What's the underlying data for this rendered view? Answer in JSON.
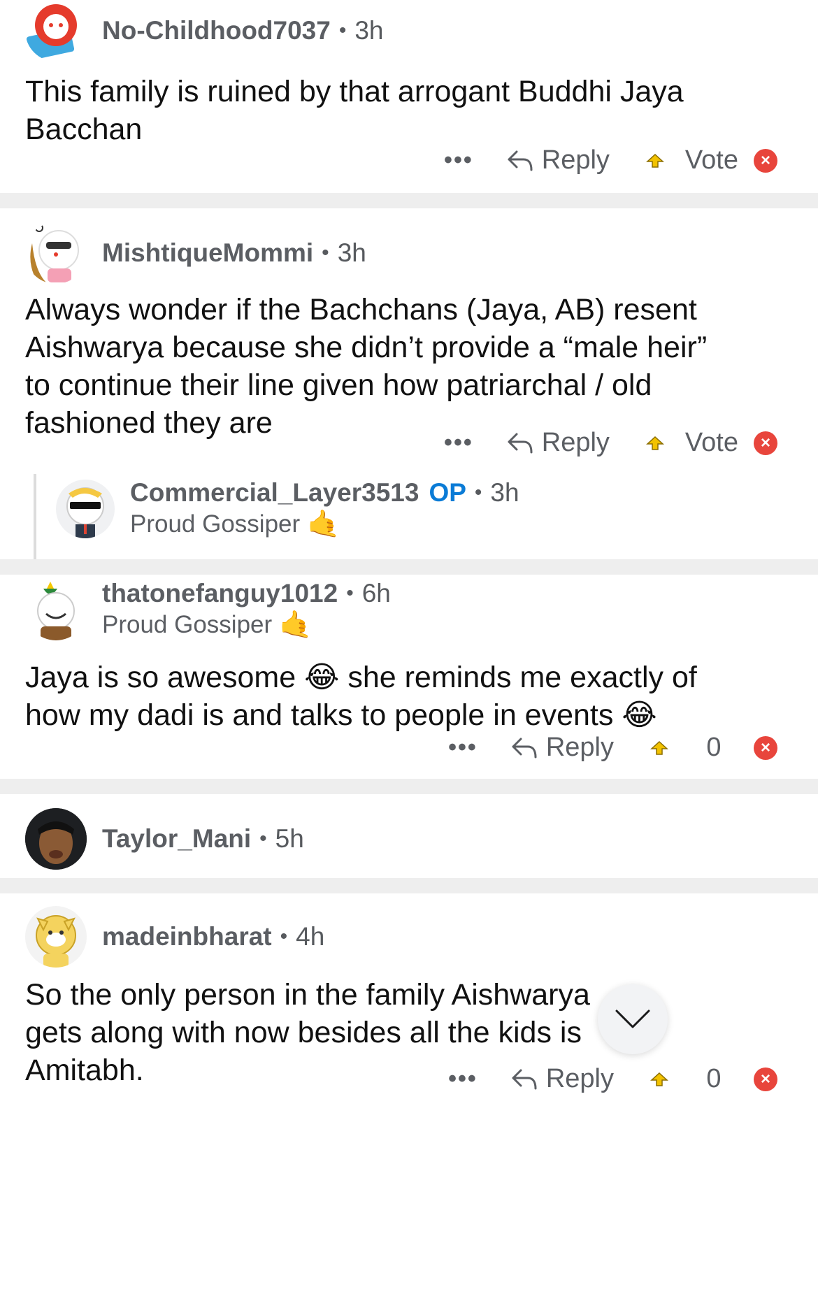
{
  "comments": [
    {
      "username": "No-Childhood7037",
      "time": "3h",
      "text": "This family is ruined by that  arrogant Buddhi Jaya Bacchan",
      "actions": {
        "more": "•••",
        "reply": "Reply",
        "vote": "Vote"
      }
    },
    {
      "username": "MishtiqueMommi",
      "time": "3h",
      "text": "Always wonder if the Bachchans (Jaya, AB) resent Aishwarya because she didn’t provide a “male heir” to continue their line given how patriarchal / old fashioned they are",
      "actions": {
        "more": "•••",
        "reply": "Reply",
        "vote": "Vote"
      },
      "reply": {
        "username": "Commercial_Layer3513",
        "op_badge": "OP",
        "time": "3h",
        "flair": "Proud Gossiper",
        "flair_emoji": "🤙"
      }
    },
    {
      "username": "thatonefanguy1012",
      "time": "6h",
      "flair": "Proud Gossiper",
      "flair_emoji": "🤙",
      "text_part1": "Jaya is so awesome",
      "emoji1": "😂",
      "text_part2": "she reminds me exactly of how my dadi is and talks to people in events",
      "emoji2": "😂",
      "actions": {
        "more": "•••",
        "reply": "Reply",
        "vote": "0"
      }
    },
    {
      "username": "Taylor_Mani",
      "time": "5h"
    },
    {
      "username": "madeinbharat",
      "time": "4h",
      "text": "So the only person in the family Aishwarya gets along with now besides all the kids is Amitabh.",
      "actions": {
        "more": "•••",
        "reply": "Reply",
        "vote": "0"
      }
    }
  ],
  "separator_dot": "•",
  "colors": {
    "op": "#0a7bd6",
    "downvote": "#e8453c",
    "upvote": "#f2c200",
    "text": "#111111",
    "meta": "#575a5e"
  },
  "icons": {
    "reply": "reply-arrow-icon",
    "upvote": "upvote-icon",
    "downvote": "downvote-icon",
    "scroll": "chevron-down-icon"
  }
}
